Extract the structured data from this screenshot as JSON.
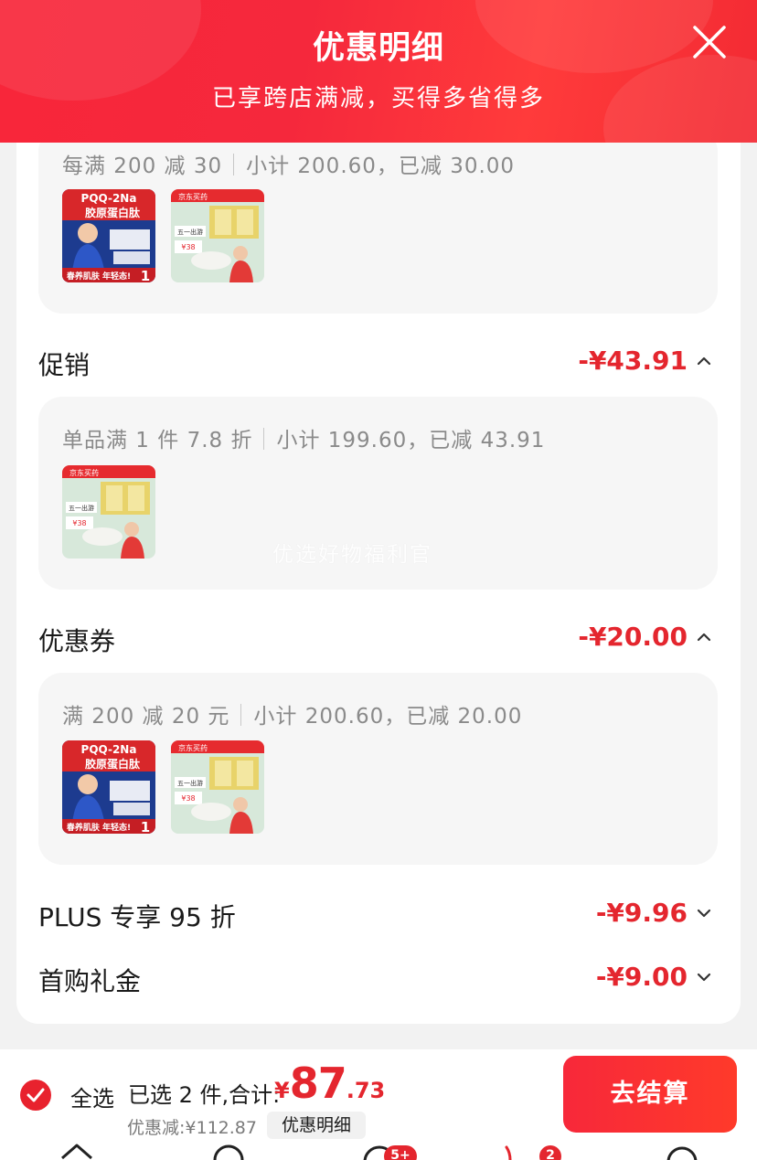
{
  "header": {
    "title": "优惠明细",
    "subtitle": "已享跨店满减，买得多省得多"
  },
  "sections": {
    "cross_store": {
      "rule": "每满 200 减 30",
      "summary": "小计 200.60，已减 30.00"
    },
    "promotion": {
      "label": "促销",
      "amount": "-¥43.91",
      "rule": "单品满 1 件 7.8 折",
      "summary": "小计 199.60，已减 43.91"
    },
    "coupon": {
      "label": "优惠券",
      "amount": "-¥20.00",
      "rule": "满 200 减 20 元",
      "summary": "小计 200.60，已减 20.00"
    },
    "plus": {
      "label": "PLUS 专享 95 折",
      "amount": "-¥9.96"
    },
    "first_gift": {
      "label": "首购礼金",
      "amount": "-¥9.00"
    }
  },
  "products": {
    "collagen": {
      "line1": "PQQ-2Na",
      "line2": "胶原蛋白肽",
      "banner": "春养肌肤 年轻态!",
      "num": "1"
    },
    "milk": {
      "brand": "京东买药",
      "tag": "五一出游",
      "price": "¥38"
    }
  },
  "watermark": "优选好物福利官",
  "bottom": {
    "select_all": "全选",
    "selected": "已选 2 件,合计:",
    "currency": "¥",
    "total_int": "87",
    "total_dec": ".73",
    "discount": "优惠减:¥112.87",
    "detail_button": "优惠明细",
    "checkout": "去结算"
  },
  "badges": {
    "messages": "5+",
    "cart": "2"
  },
  "colors": {
    "accent": "#e4262e",
    "header": "#f8263a"
  }
}
